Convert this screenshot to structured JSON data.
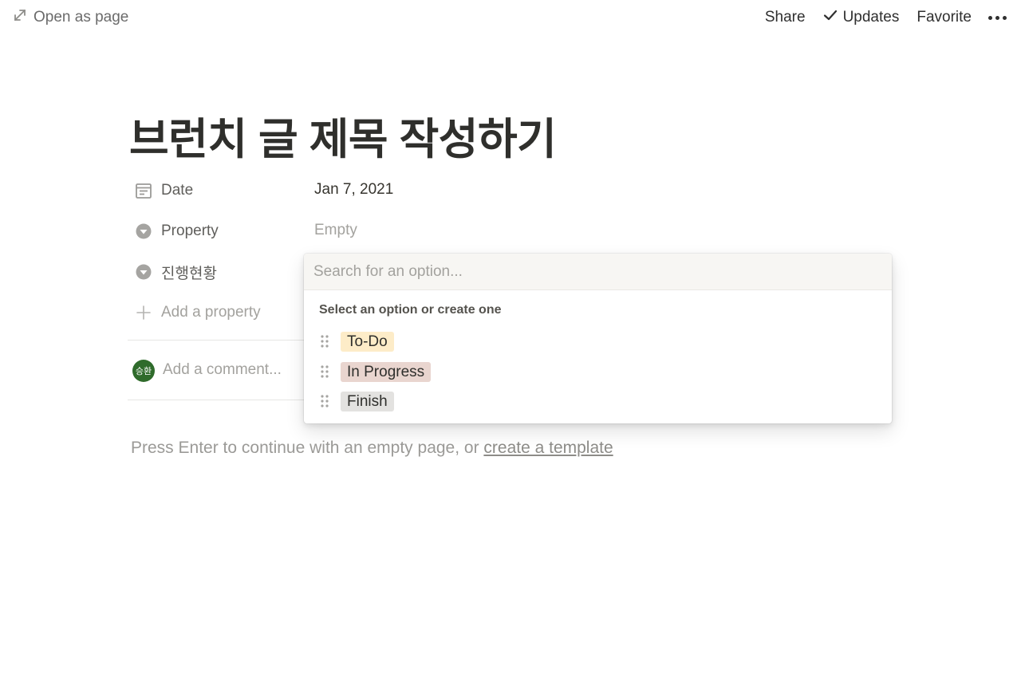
{
  "topbar": {
    "open_as_page": "Open as page",
    "share": "Share",
    "updates": "Updates",
    "favorite": "Favorite"
  },
  "page": {
    "title": "브런치 글 제목 작성하기"
  },
  "properties": {
    "date": {
      "label": "Date",
      "value": "Jan 7, 2021"
    },
    "property": {
      "label": "Property",
      "value": "Empty"
    },
    "status": {
      "label": "진행현황"
    },
    "add_property": "Add a property"
  },
  "comment": {
    "avatar_text": "승환",
    "placeholder": "Add a comment..."
  },
  "hint": {
    "prefix": "Press Enter to continue with an empty page, or ",
    "link": "create a template"
  },
  "dropdown": {
    "search_placeholder": "Search for an option...",
    "heading": "Select an option or create one",
    "options": [
      {
        "label": "To-Do",
        "color": "#fdecc8"
      },
      {
        "label": "In Progress",
        "color": "#e9d5cf"
      },
      {
        "label": "Finish",
        "color": "#e3e2e0"
      }
    ]
  },
  "colors": {
    "text": "#37352f",
    "muted": "#9b9a97",
    "avatar_bg": "#2f6b2b"
  }
}
